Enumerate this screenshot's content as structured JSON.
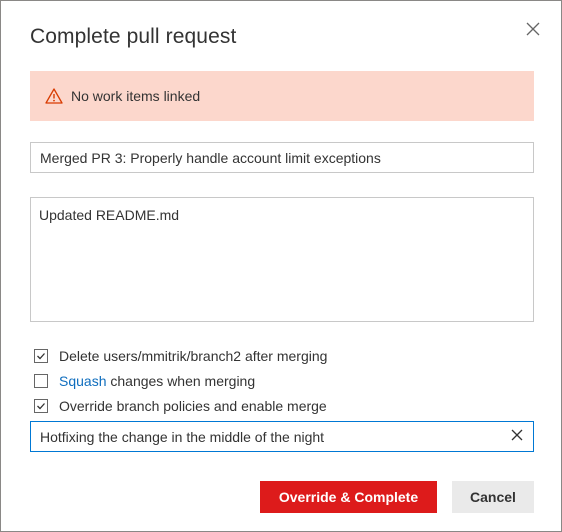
{
  "dialog": {
    "title": "Complete pull request",
    "close_icon": "close-icon"
  },
  "warning": {
    "icon": "warning-icon",
    "text": "No work items linked",
    "background": "#fcd7cc",
    "icon_color": "#d83b01"
  },
  "merge": {
    "title_value": "Merged PR 3: Properly handle account limit exceptions",
    "description_value": "Updated README.md"
  },
  "options": [
    {
      "checked": true,
      "text": "Delete users/mmitrik/branch2 after merging"
    },
    {
      "checked": false,
      "link_text": "Squash",
      "text": "changes when merging"
    },
    {
      "checked": true,
      "text": "Override branch policies and enable merge"
    }
  ],
  "bypass_reason": {
    "value": "Hotfixing the change in the middle of the night",
    "clear_icon": "clear-icon",
    "border_color": "#0078d4"
  },
  "buttons": {
    "primary_label": "Override & Complete",
    "primary_color": "#dd1b1b",
    "secondary_label": "Cancel"
  },
  "colors": {
    "link": "#106ebe"
  }
}
